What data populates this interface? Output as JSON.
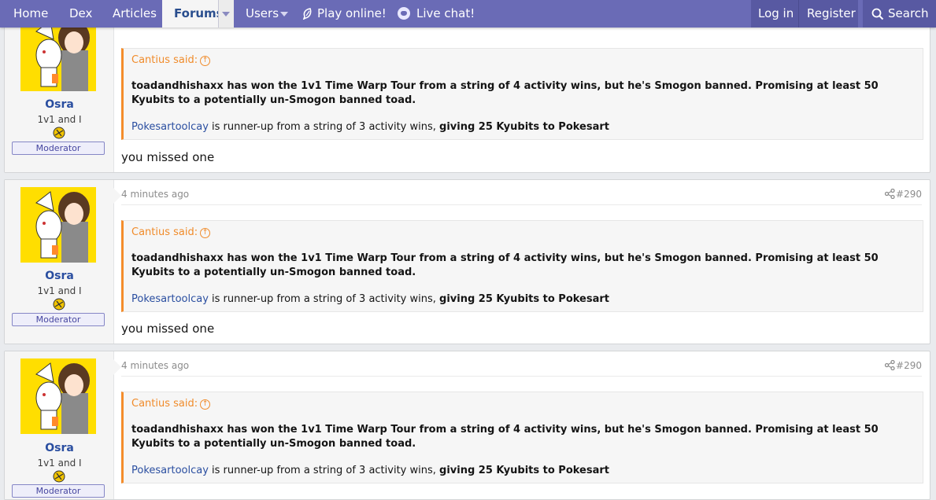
{
  "nav": {
    "home": "Home",
    "dex": "Dex",
    "articles": "Articles",
    "forums": "Forums",
    "users": "Users",
    "play_online": "Play online!",
    "live_chat": "Live chat!",
    "login": "Log in",
    "register": "Register",
    "search": "Search"
  },
  "colors": {
    "nav_bg": "#6a6bb6",
    "quote_accent": "#f48d2c",
    "link": "#2a4ea0",
    "avatar_bg": "#ffde00"
  },
  "posts": [
    {
      "username": "Osra",
      "user_title": "1v1 and I",
      "user_banner": "Moderator",
      "time": "",
      "post_number": "",
      "quote_author": "Cantius said:",
      "quote_text": "toadandhishaxx has won the 1v1 Time Warp Tour from a string of 4 activity wins, but he's Smogon banned. Promising at least 50 Kyubits to a potentially un-Smogon banned toad.",
      "quote_link": "Pokesartoolcay",
      "quote_mid": " is runner-up from a string of 3 activity wins, ",
      "quote_bold": "giving 25 Kyubits to Pokesart",
      "reply": "you missed one"
    },
    {
      "username": "Osra",
      "user_title": "1v1 and I",
      "user_banner": "Moderator",
      "time": "4 minutes ago",
      "post_number": "#290",
      "quote_author": "Cantius said:",
      "quote_text": "toadandhishaxx has won the 1v1 Time Warp Tour from a string of 4 activity wins, but he's Smogon banned. Promising at least 50 Kyubits to a potentially un-Smogon banned toad.",
      "quote_link": "Pokesartoolcay",
      "quote_mid": " is runner-up from a string of 3 activity wins, ",
      "quote_bold": "giving 25 Kyubits to Pokesart",
      "reply": "you missed one"
    },
    {
      "username": "Osra",
      "user_title": "1v1 and I",
      "user_banner": "Moderator",
      "time": "4 minutes ago",
      "post_number": "#290",
      "quote_author": "Cantius said:",
      "quote_text": "toadandhishaxx has won the 1v1 Time Warp Tour from a string of 4 activity wins, but he's Smogon banned. Promising at least 50 Kyubits to a potentially un-Smogon banned toad.",
      "quote_link": "Pokesartoolcay",
      "quote_mid": " is runner-up from a string of 3 activity wins, ",
      "quote_bold": "giving 25 Kyubits to Pokesart",
      "reply": ""
    }
  ],
  "icons": {
    "share": "share-icon",
    "quote_up": "arrow-up-circle-icon",
    "badge": "sun-badge-icon"
  }
}
